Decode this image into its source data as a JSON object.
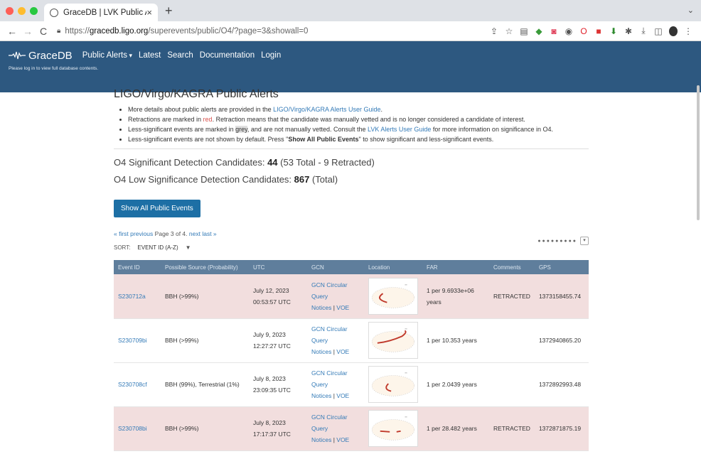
{
  "browser": {
    "tab_title": "GraceDB | LVK Public Alerts",
    "url_prefix": "https://",
    "url_host": "gracedb.ligo.org",
    "url_path": "/superevents/public/O4/?page=3&showall=0"
  },
  "site": {
    "brand": "GraceDB",
    "nav": [
      "Public Alerts",
      "Latest",
      "Search",
      "Documentation",
      "Login"
    ],
    "login_msg": "Please log in to view full database contents."
  },
  "page": {
    "title": "LIGO/Virgo/KAGRA Public Alerts",
    "bullet1_a": "More details about public alerts are provided in the ",
    "bullet1_link": "LIGO/Virgo/KAGRA Alerts User Guide",
    "bullet1_b": ".",
    "bullet2_a": "Retractions are marked in ",
    "bullet2_red": "red",
    "bullet2_b": ". Retraction means that the candidate was manually vetted and is no longer considered a candidate of interest.",
    "bullet3_a": "Less-significant events are marked in ",
    "bullet3_grey": "grey",
    "bullet3_b": ", and are not manually vetted. Consult the ",
    "bullet3_link": "LVK Alerts User Guide",
    "bullet3_c": " for more information on significance in O4.",
    "bullet4_a": "Less-significant events are not shown by default. Press \"",
    "bullet4_bold": "Show All Public Events",
    "bullet4_b": "\" to show significant and less-significant events.",
    "sig_label": "O4 Significant Detection Candidates: ",
    "sig_count": "44",
    "sig_detail": " (53 Total - 9 Retracted)",
    "low_label": "O4 Low Significance Detection Candidates: ",
    "low_count": "867",
    "low_detail": " (Total)",
    "show_all_button": "Show All Public Events",
    "pager_first": "« first",
    "pager_prev": "previous",
    "pager_text": "Page 3 of 4.",
    "pager_next": "next",
    "pager_last": "last »",
    "sort_label": "SORT:",
    "sort_value": "EVENT ID (A-Z)"
  },
  "table": {
    "headers": [
      "Event ID",
      "Possible Source (Probability)",
      "UTC",
      "GCN",
      "Location",
      "FAR",
      "Comments",
      "GPS"
    ],
    "gcn_links": {
      "circular": "GCN Circular",
      "query": "Query",
      "notices": "Notices",
      "sep": " | ",
      "voe": "VOE"
    },
    "rows": [
      {
        "id": "S230712a",
        "source": "BBH (>99%)",
        "date": "July 12, 2023",
        "time": "00:53:57 UTC",
        "far": "1 per 9.6933e+06 years",
        "comment": "RETRACTED",
        "gps": "1373158455.74",
        "retracted": true
      },
      {
        "id": "S230709bi",
        "source": "BBH (>99%)",
        "date": "July 9, 2023",
        "time": "12:27:27 UTC",
        "far": "1 per 10.353 years",
        "comment": "",
        "gps": "1372940865.20",
        "retracted": false
      },
      {
        "id": "S230708cf",
        "source": "BBH (99%), Terrestrial (1%)",
        "date": "July 8, 2023",
        "time": "23:09:35 UTC",
        "far": "1 per 2.0439 years",
        "comment": "",
        "gps": "1372892993.48",
        "retracted": false
      },
      {
        "id": "S230708bi",
        "source": "BBH (>99%)",
        "date": "July 8, 2023",
        "time": "17:17:37 UTC",
        "far": "1 per 28.482 years",
        "comment": "RETRACTED",
        "gps": "1372871875.19",
        "retracted": true
      }
    ]
  },
  "colors": {
    "navbar": "#2d5880",
    "table_header": "#5f7e9c",
    "retracted_row": "#f2dede",
    "link": "#337ab7",
    "button": "#1d6fa5"
  }
}
